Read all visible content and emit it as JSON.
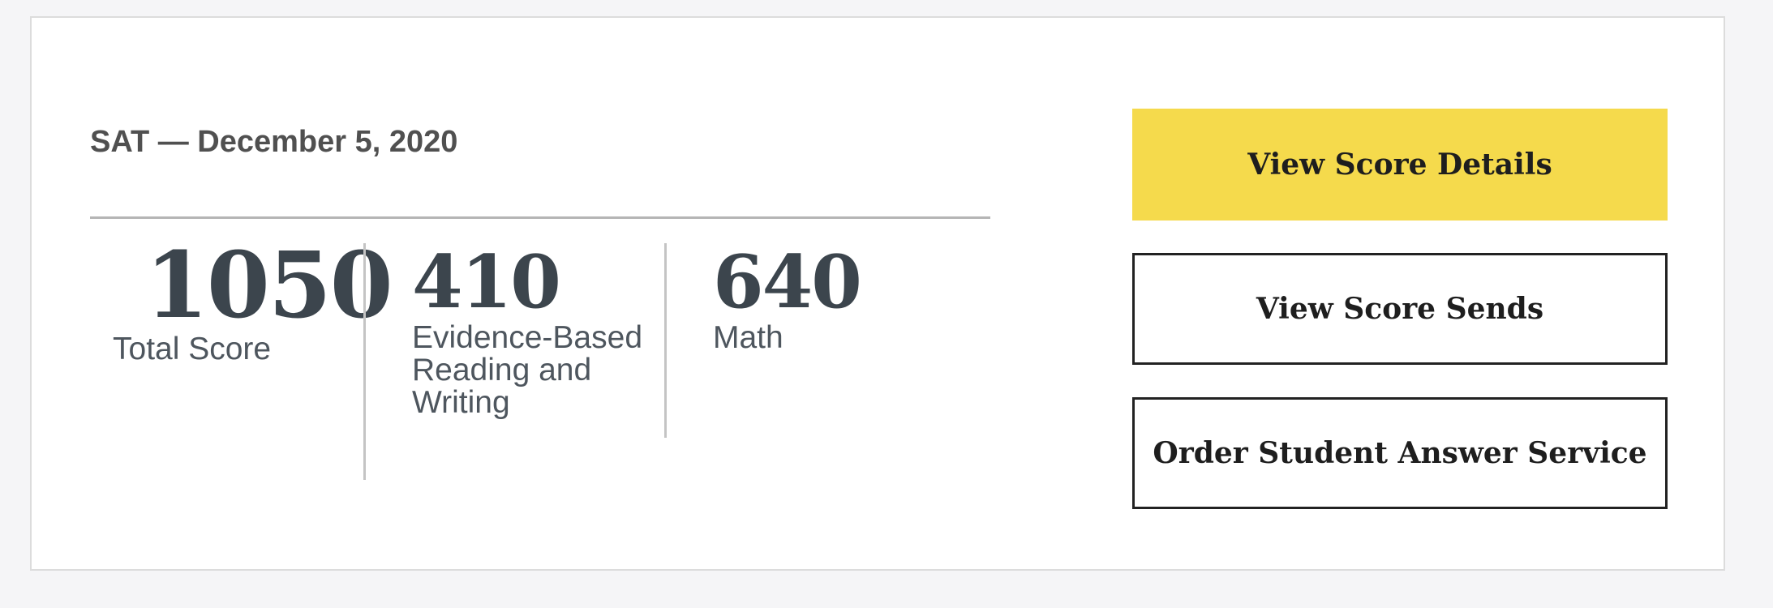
{
  "test": {
    "title": "SAT — December 5, 2020"
  },
  "scores": {
    "total": {
      "value": "1050",
      "label": "Total Score"
    },
    "ebrw": {
      "value": "410",
      "label": "Evidence-Based Reading and Writing"
    },
    "math": {
      "value": "640",
      "label": "Math"
    }
  },
  "actions": {
    "view_details": "View Score Details",
    "view_sends": "View Score Sends",
    "order_sas": "Order Student Answer Service"
  },
  "colors": {
    "primary_button": "#f5da4c",
    "score_text": "#3c454d",
    "title_text": "#505050"
  }
}
